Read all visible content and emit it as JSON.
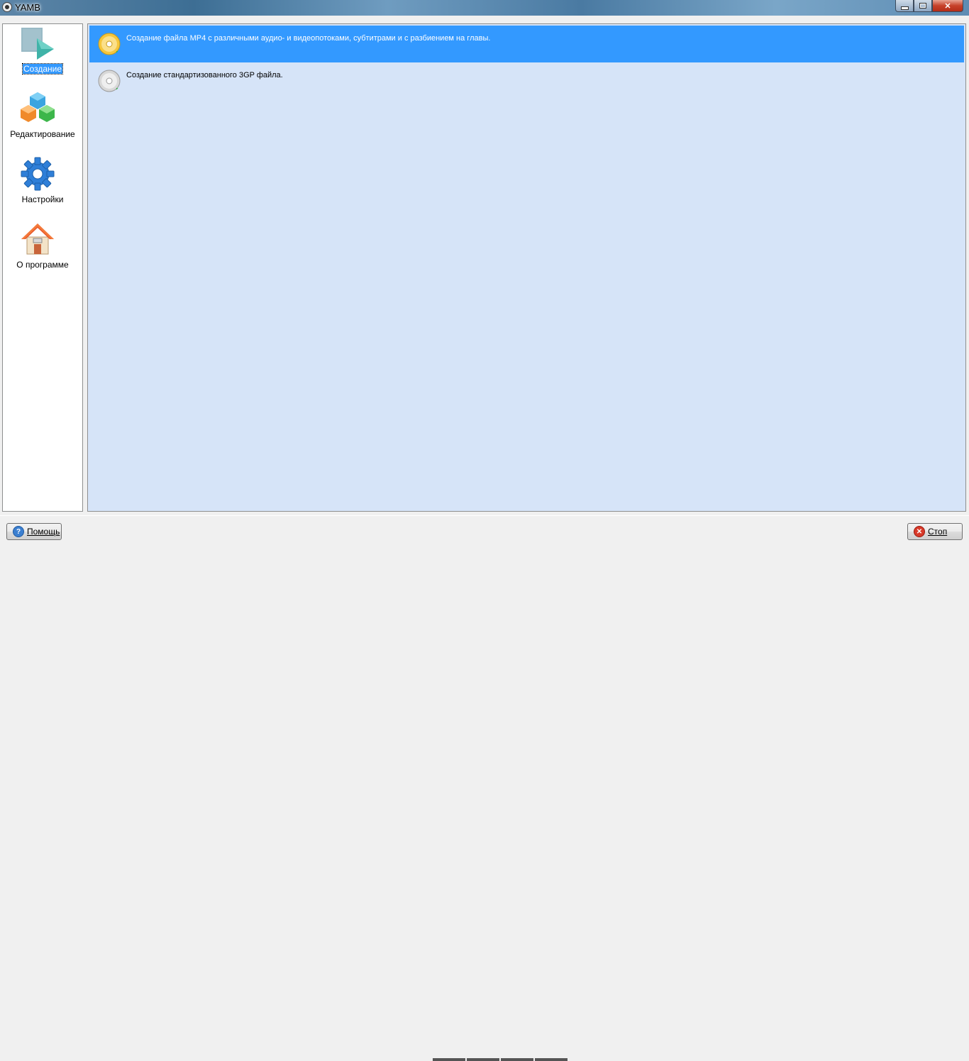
{
  "window": {
    "title": "YAMB"
  },
  "sidebar": {
    "items": [
      {
        "label": "Создание",
        "icon": "create-icon",
        "selected": true
      },
      {
        "label": "Редактирование",
        "icon": "cubes-icon",
        "selected": false
      },
      {
        "label": "Настройки",
        "icon": "gear-icon",
        "selected": false
      },
      {
        "label": "О программе",
        "icon": "house-icon",
        "selected": false
      }
    ]
  },
  "tasks": [
    {
      "text": "Создание файла MP4 с различными аудио- и видеопотоками, субтитрами и с разбиением на главы.",
      "icon": "gold-disc-icon",
      "selected": true
    },
    {
      "text": "Создание стандартизованного 3GP файла.",
      "icon": "silver-disc-icon",
      "selected": false
    }
  ],
  "buttons": {
    "help": "Помощь",
    "stop": "Стоп"
  },
  "colors": {
    "selection": "#3399ff",
    "content_bg": "#d6e4f8"
  }
}
